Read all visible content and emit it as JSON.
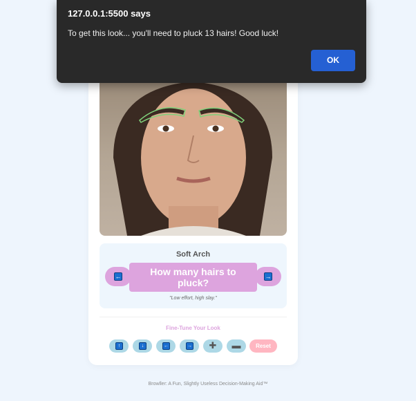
{
  "dialog": {
    "title": "127.0.0.1:5500 says",
    "message": "To get this look... you'll need to pluck 13 hairs! Good luck!",
    "ok_label": "OK"
  },
  "style_panel": {
    "style_name": "Soft Arch",
    "question": "How many hairs to pluck?",
    "tagline": "\"Low effort, high slay.\"",
    "prev_icon": "left-arrow-key-icon",
    "next_icon": "right-arrow-key-icon"
  },
  "fine_tune": {
    "title": "Fine-Tune Your Look",
    "tools": [
      {
        "name": "up",
        "icon": "up-arrow-key-icon",
        "glyph": "↑"
      },
      {
        "name": "down",
        "icon": "down-arrow-key-icon",
        "glyph": "↓"
      },
      {
        "name": "left",
        "icon": "left-arrow-key-icon",
        "glyph": "←"
      },
      {
        "name": "right",
        "icon": "right-arrow-key-icon",
        "glyph": "→"
      },
      {
        "name": "grow",
        "icon": "plus-icon",
        "glyph": "➕"
      },
      {
        "name": "shrink",
        "icon": "minus-icon",
        "glyph": "➖"
      }
    ],
    "reset_label": "Reset"
  },
  "footer": "Browller: A Fun, Slightly Useless Decision-Making Aid™",
  "colors": {
    "accent": "#dda4de",
    "tool_bg": "#add8e6",
    "reset_bg": "#ffb6c1",
    "ok_button": "#2560d3",
    "eyebrow_outline": "#7fd07a"
  }
}
